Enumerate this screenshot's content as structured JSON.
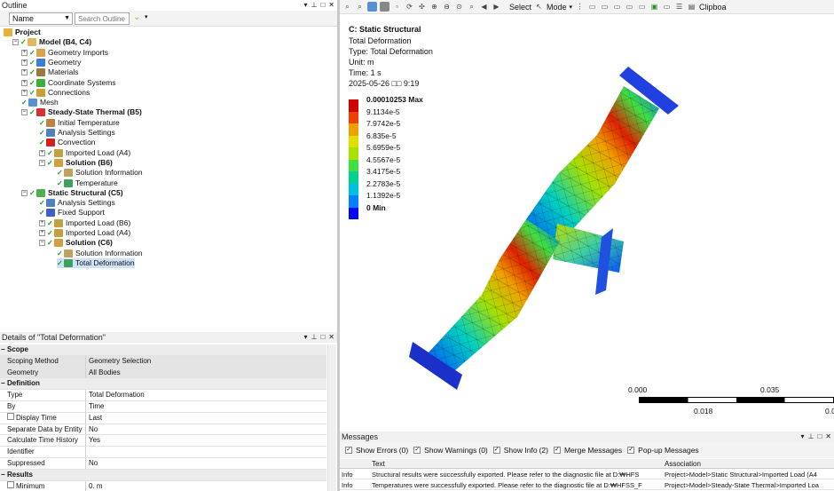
{
  "outline": {
    "title": "Outline",
    "name_combo": "Name",
    "search_placeholder": "Search Outline",
    "tree": [
      {
        "label": "Project",
        "level": 0,
        "bold": true,
        "icon": "project-icon",
        "color": "#e8b23a"
      },
      {
        "label": "Model (B4, C4)",
        "level": 1,
        "bold": true,
        "icon": "model-icon",
        "color": "#e0b75a"
      },
      {
        "label": "Geometry Imports",
        "level": 2,
        "icon": "geometry-imports-icon",
        "color": "#d9a24a"
      },
      {
        "label": "Geometry",
        "level": 2,
        "icon": "geometry-icon",
        "color": "#3b7fd4"
      },
      {
        "label": "Materials",
        "level": 2,
        "icon": "materials-icon",
        "color": "#9a7a40"
      },
      {
        "label": "Coordinate Systems",
        "level": 2,
        "icon": "coordinate-systems-icon",
        "color": "#3ab03a"
      },
      {
        "label": "Connections",
        "level": 2,
        "icon": "connections-icon",
        "color": "#c8a030"
      },
      {
        "label": "Mesh",
        "level": 2,
        "icon": "mesh-icon",
        "color": "#5a8fd0"
      },
      {
        "label": "Steady-State Thermal (B5)",
        "level": 2,
        "bold": true,
        "icon": "thermal-analysis-icon",
        "color": "#d83030"
      },
      {
        "label": "Initial Temperature",
        "level": 3,
        "icon": "initial-temperature-icon",
        "color": "#c08040"
      },
      {
        "label": "Analysis Settings",
        "level": 3,
        "icon": "analysis-settings-icon",
        "color": "#5080c0"
      },
      {
        "label": "Convection",
        "level": 3,
        "icon": "convection-icon",
        "color": "#d02020"
      },
      {
        "label": "Imported Load (A4)",
        "level": 3,
        "icon": "imported-load-icon",
        "color": "#c0a040"
      },
      {
        "label": "Solution (B6)",
        "level": 3,
        "bold": true,
        "icon": "solution-icon",
        "color": "#d0a040"
      },
      {
        "label": "Solution Information",
        "level": 4,
        "icon": "solution-information-icon",
        "color": "#c0a060"
      },
      {
        "label": "Temperature",
        "level": 4,
        "icon": "temperature-result-icon",
        "color": "#40a060"
      },
      {
        "label": "Static Structural (C5)",
        "level": 2,
        "bold": true,
        "icon": "static-structural-icon",
        "color": "#50b050"
      },
      {
        "label": "Analysis Settings",
        "level": 3,
        "icon": "analysis-settings-icon",
        "color": "#5080c0"
      },
      {
        "label": "Fixed Support",
        "level": 3,
        "icon": "fixed-support-icon",
        "color": "#4060c0"
      },
      {
        "label": "Imported Load (B6)",
        "level": 3,
        "icon": "imported-load-icon",
        "color": "#c0a040"
      },
      {
        "label": "Imported Load (A4)",
        "level": 3,
        "icon": "imported-load-icon",
        "color": "#c0a040"
      },
      {
        "label": "Solution (C6)",
        "level": 3,
        "bold": true,
        "icon": "solution-icon",
        "color": "#d0a040"
      },
      {
        "label": "Solution Information",
        "level": 4,
        "icon": "solution-information-icon",
        "color": "#c0a060"
      },
      {
        "label": "Total Deformation",
        "level": 4,
        "icon": "total-deformation-icon",
        "color": "#40a060",
        "selected": true
      }
    ]
  },
  "details": {
    "title": "Details of \"Total Deformation\"",
    "rows": [
      {
        "type": "group",
        "k": "Scope"
      },
      {
        "k": "Scoping Method",
        "v": "Geometry Selection",
        "hl": true
      },
      {
        "k": "Geometry",
        "v": "All Bodies",
        "hl": true
      },
      {
        "type": "group",
        "k": "Definition"
      },
      {
        "k": "Type",
        "v": "Total Deformation"
      },
      {
        "k": "By",
        "v": "Time"
      },
      {
        "k": "Display Time",
        "v": "Last",
        "cb": true
      },
      {
        "k": "Separate Data by Entity",
        "v": "No"
      },
      {
        "k": "Calculate Time History",
        "v": "Yes"
      },
      {
        "k": "Identifier",
        "v": ""
      },
      {
        "k": "Suppressed",
        "v": "No"
      },
      {
        "type": "group",
        "k": "Results"
      },
      {
        "k": "Minimum",
        "v": "0. m",
        "cb": true
      }
    ]
  },
  "toolbar": {
    "select_label": "Select",
    "mode_label": "Mode",
    "clipboard_label": "Clipboa"
  },
  "graphics": {
    "title": "C: Static Structural",
    "subtitle": "Total Deformation",
    "type_line": "Type: Total Deformation",
    "unit_line": "Unit: m",
    "time_line": "Time: 1 s",
    "date_line": "2025-05-26 □□ 9:19",
    "legend": [
      {
        "label": "0.00010253 Max",
        "color": "#d40000",
        "bold": true
      },
      {
        "label": "9.1134e-5",
        "color": "#f04000"
      },
      {
        "label": "7.9742e-5",
        "color": "#f0a000"
      },
      {
        "label": "6.835e-5",
        "color": "#e0e000"
      },
      {
        "label": "5.6959e-5",
        "color": "#a8e000"
      },
      {
        "label": "4.5567e-5",
        "color": "#40e040"
      },
      {
        "label": "3.4175e-5",
        "color": "#00d090"
      },
      {
        "label": "2.2783e-5",
        "color": "#00c0e0"
      },
      {
        "label": "1.1392e-5",
        "color": "#0080ff"
      },
      {
        "label": "0 Min",
        "color": "#0000ff",
        "bold": true
      }
    ],
    "scale": {
      "t0": "0.000",
      "t1": "0.035",
      "t2": "0.018",
      "t3": "0.0"
    }
  },
  "messages": {
    "title": "Messages",
    "filters": [
      {
        "label": "Show Errors",
        "count": "(0)"
      },
      {
        "label": "Show Warnings",
        "count": "(0)"
      },
      {
        "label": "Show Info",
        "count": "(2)"
      },
      {
        "label": "Merge Messages",
        "count": ""
      },
      {
        "label": "Pop-up Messages",
        "count": ""
      }
    ],
    "columns": [
      "Text",
      "Association"
    ],
    "rows": [
      {
        "type": "Info",
        "text": "Structural results were successfully exported. Please refer to the diagnostic file at D:₩HFS",
        "assoc": "Project>Model>Static Structural>Imported Load (A4"
      },
      {
        "type": "Info",
        "text": "Temperatures were successfully exported. Please refer to the diagnostic file at D:₩HFSS_F",
        "assoc": "Project>Model>Steady-State Thermal>Imported Loa"
      }
    ]
  }
}
